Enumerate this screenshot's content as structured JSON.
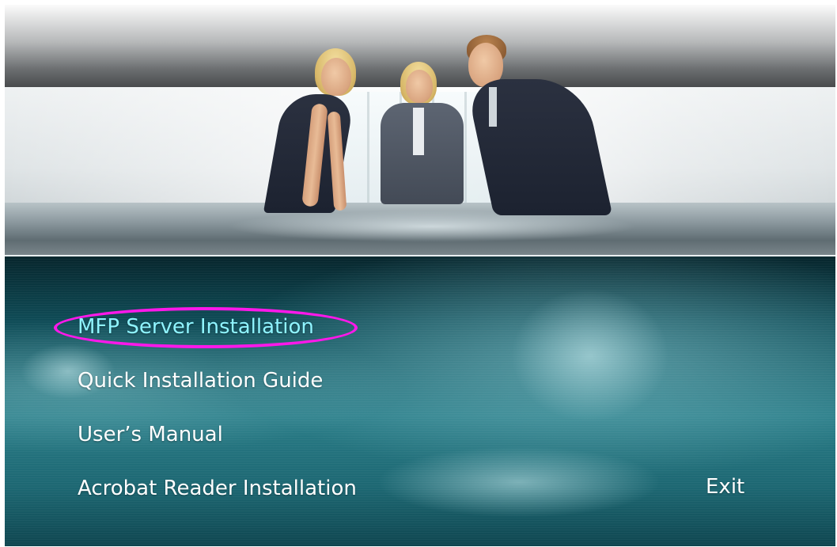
{
  "banner": {
    "image": "three-business-people-at-conference-table"
  },
  "menu": {
    "items": [
      {
        "label": "MFP Server Installation",
        "state": "highlighted"
      },
      {
        "label": "Quick Installation Guide",
        "state": "normal"
      },
      {
        "label": "User’s Manual",
        "state": "normal"
      },
      {
        "label": "Acrobat Reader Installation",
        "state": "normal"
      }
    ],
    "exit_label": "Exit"
  },
  "colors": {
    "menu_background": "#1d6772",
    "menu_text": "#ffffff",
    "active_text": "#8ff4ff",
    "highlight_ellipse": "#ff18ea"
  }
}
